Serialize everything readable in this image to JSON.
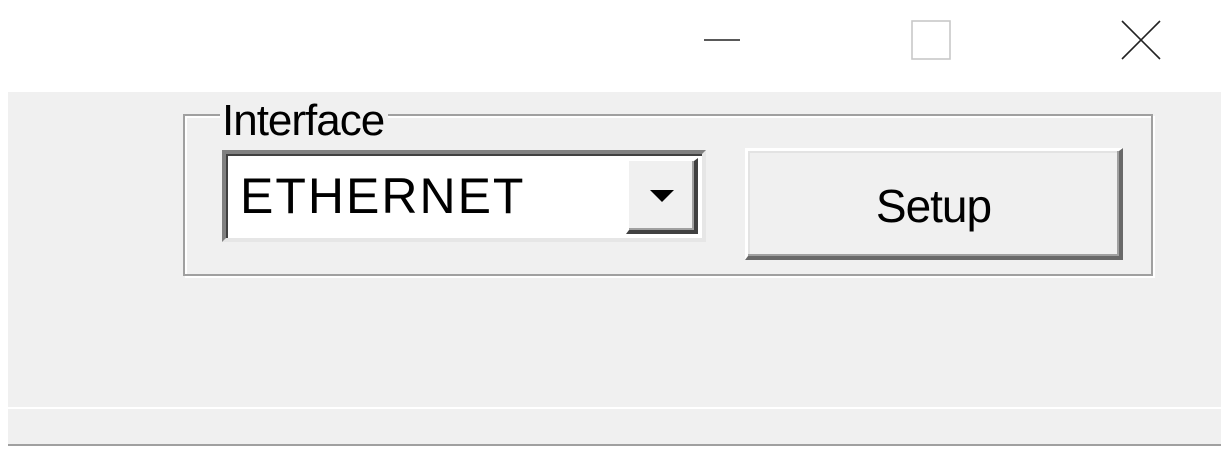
{
  "window": {
    "controls": {
      "minimize_icon": "minimize-icon",
      "maximize_icon": "maximize-icon",
      "close_icon": "close-icon"
    }
  },
  "interface_group": {
    "legend": "Interface",
    "combo": {
      "selected_value": "ETHERNET",
      "arrow_icon": "dropdown-arrow-icon"
    },
    "setup_label": "Setup"
  },
  "colors": {
    "face": "#f0f0f0",
    "titlebar": "#ffffff",
    "border_dark": "#a0a0a0",
    "text": "#000000"
  }
}
